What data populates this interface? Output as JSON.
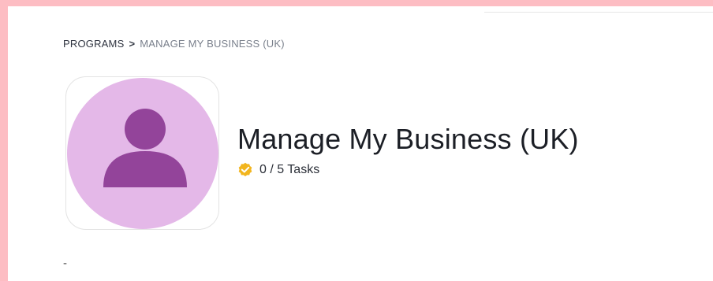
{
  "breadcrumb": {
    "root": "PROGRAMS",
    "separator": ">",
    "current": "MANAGE MY BUSINESS (UK)"
  },
  "program": {
    "title": "Manage My Business (UK)",
    "tasks_label": "0 / 5 Tasks",
    "tasks_completed": 0,
    "tasks_total": 5,
    "description": "-",
    "logo_icon": "user-avatar-icon",
    "status_icon": "check-badge-icon"
  },
  "colors": {
    "page_background": "#fdbdc3",
    "logo_circle": "#e4b8e8",
    "logo_figure": "#93449a",
    "check_badge": "#f2b51e"
  }
}
